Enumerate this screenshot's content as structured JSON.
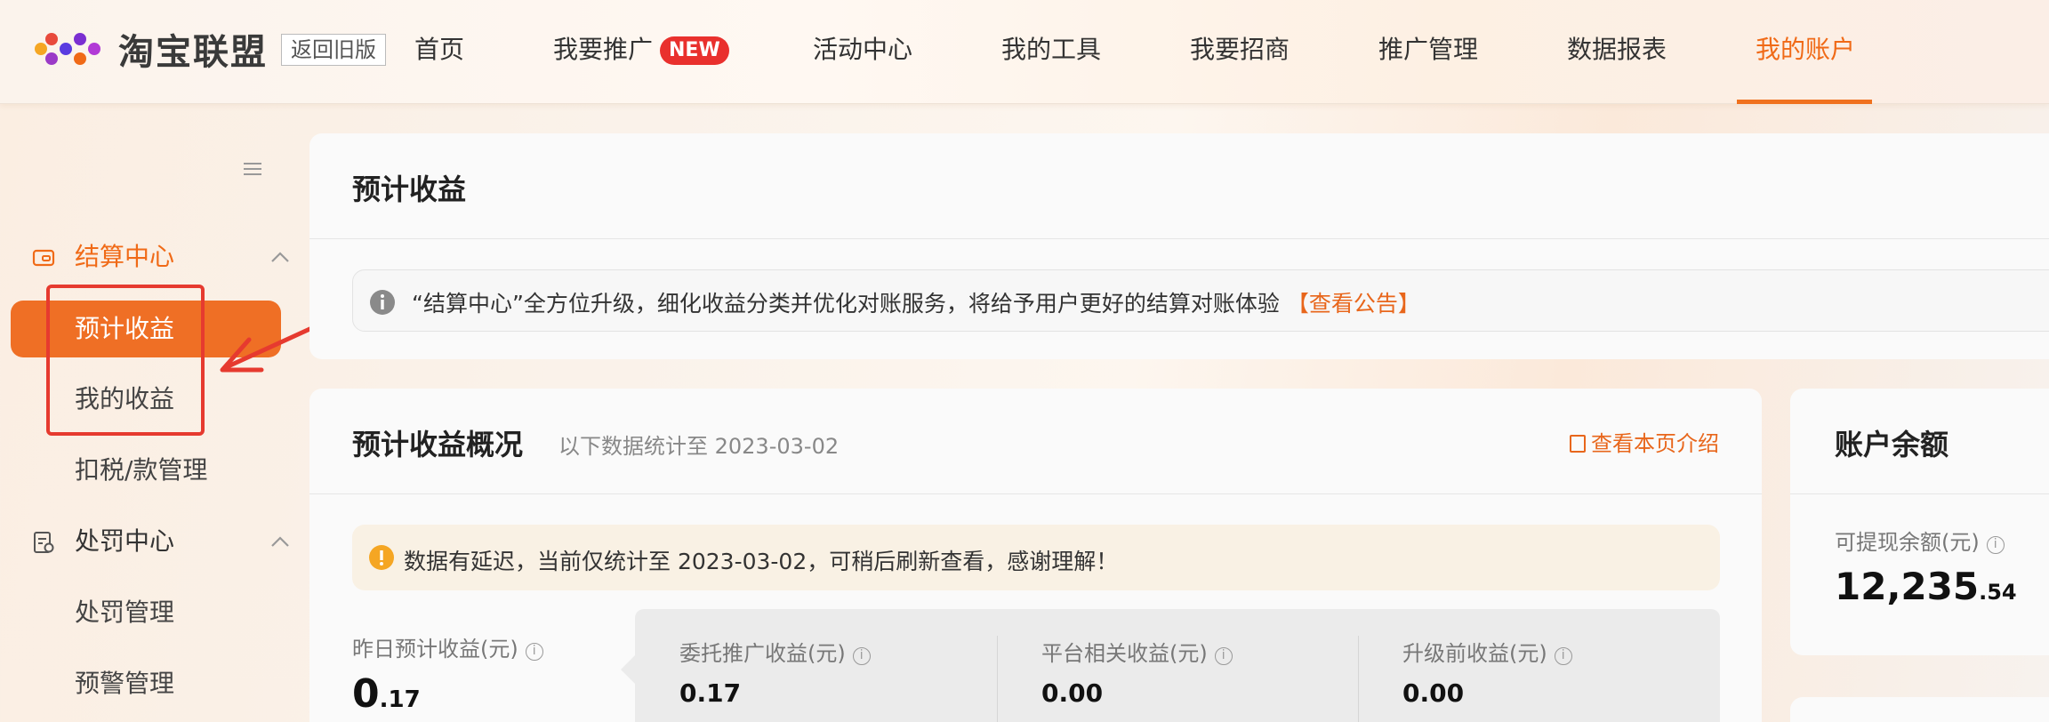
{
  "header": {
    "brand": "淘宝联盟",
    "old_version": "返回旧版",
    "nav": [
      {
        "label": "首页"
      },
      {
        "label": "我要推广",
        "badge": "NEW"
      },
      {
        "label": "活动中心"
      },
      {
        "label": "我的工具"
      },
      {
        "label": "我要招商"
      },
      {
        "label": "推广管理"
      },
      {
        "label": "数据报表"
      },
      {
        "label": "我的账户"
      }
    ]
  },
  "sidebar": {
    "sections": [
      {
        "label": "结算中心",
        "items": [
          "预计收益",
          "我的收益",
          "扣税/款管理"
        ]
      },
      {
        "label": "处罚中心",
        "items": [
          "处罚管理",
          "预警管理"
        ]
      }
    ]
  },
  "estimate_card": {
    "title": "预计收益",
    "notice_text": "“结算中心”全方位升级，细化收益分类并优化对账服务，将给予用户更好的结算对账体验",
    "notice_link": "【查看公告】"
  },
  "overview_card": {
    "title": "预计收益概况",
    "subtitle": "以下数据统计至 2023-03-02",
    "intro_link": "查看本页介绍",
    "warning": "数据有延迟，当前仅统计至 2023-03-02，可稍后刷新查看，感谢理解！",
    "yesterday_label": "昨日预计收益(元)",
    "yesterday_int": "0",
    "yesterday_dec": ".17",
    "breakdown": [
      {
        "label": "委托推广收益(元)",
        "value": "0.17"
      },
      {
        "label": "平台相关收益(元)",
        "value": "0.00"
      },
      {
        "label": "升级前收益(元)",
        "value": "0.00"
      }
    ]
  },
  "balance_card": {
    "title": "账户余额",
    "withdrawable_label": "可提现余额(元)",
    "amount_int": "12,235",
    "amount_dec": ".54"
  },
  "colors": {
    "accent": "#f06a17",
    "annotation": "#e63a2f"
  }
}
